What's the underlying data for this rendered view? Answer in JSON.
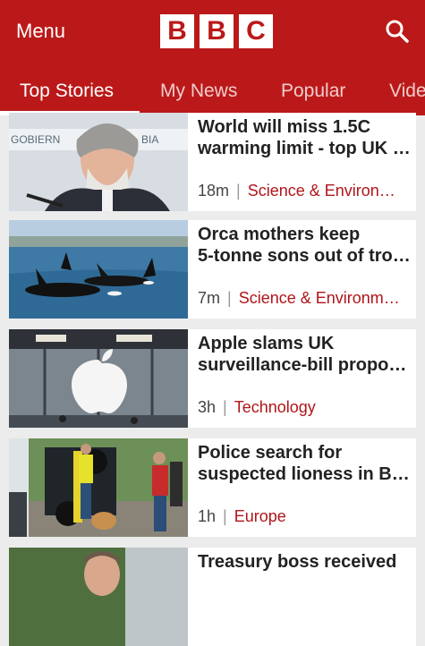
{
  "header": {
    "menu_label": "Menu",
    "logo_letters": [
      "B",
      "B",
      "C"
    ],
    "search_icon": "search-icon",
    "brand_color": "#bb1919"
  },
  "tabs": [
    {
      "label": "Top Stories"
    },
    {
      "label": "My News"
    },
    {
      "label": "Popular"
    },
    {
      "label": "Vide"
    }
  ],
  "stories": [
    {
      "line1": "World will miss 1.5C",
      "line2": "warming limit - top UK e…",
      "time": "18m",
      "topic": "Science & Environ…"
    },
    {
      "line1": "Orca mothers keep",
      "line2": "5-tonne sons out of trou…",
      "time": "7m",
      "topic": "Science & Environm…"
    },
    {
      "line1": "Apple slams UK",
      "line2": "surveillance-bill propos…",
      "time": "3h",
      "topic": "Technology"
    },
    {
      "line1": "Police search for",
      "line2": "suspected lioness in Be…",
      "time": "1h",
      "topic": "Europe"
    },
    {
      "line1": "Treasury boss received",
      "line2": "",
      "time": "",
      "topic": ""
    }
  ],
  "thumb_texts": {
    "podium_sign": "GOBIERN",
    "podium_sign_right": "BIA"
  }
}
